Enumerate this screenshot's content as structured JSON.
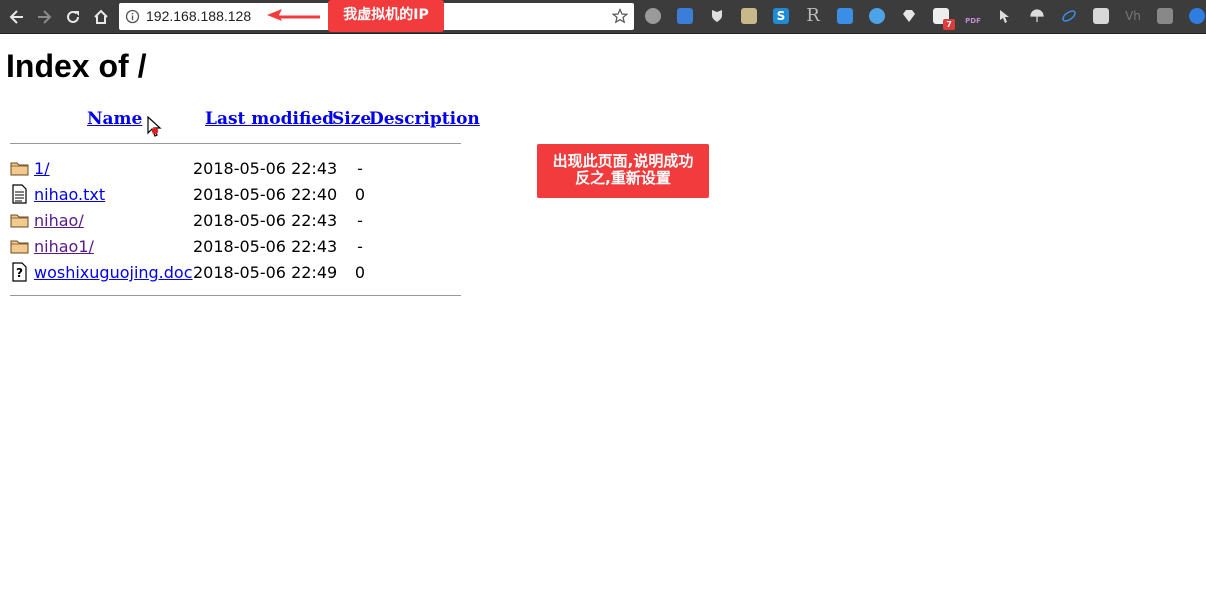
{
  "browser": {
    "url": "192.168.188.128",
    "callout_ip": "我虚拟机的IP"
  },
  "page": {
    "title": "Index of /",
    "columns": {
      "name": "Name",
      "last_modified": "Last modified",
      "size": "Size",
      "description": "Description"
    },
    "entries": [
      {
        "icon": "folder-icon",
        "name": "1/",
        "modified": "2018-05-06 22:43",
        "size": "-",
        "visited": false
      },
      {
        "icon": "text-file-icon",
        "name": "nihao.txt",
        "modified": "2018-05-06 22:40",
        "size": "0",
        "visited": false
      },
      {
        "icon": "folder-icon",
        "name": "nihao/",
        "modified": "2018-05-06 22:43",
        "size": "-",
        "visited": true
      },
      {
        "icon": "folder-icon",
        "name": "nihao1/",
        "modified": "2018-05-06 22:43",
        "size": "-",
        "visited": true
      },
      {
        "icon": "unknown-file-icon",
        "name": "woshixuguojing.doc",
        "modified": "2018-05-06 22:49",
        "size": "0",
        "visited": false
      }
    ]
  },
  "annotation": {
    "line1": "出现此页面,说明成功",
    "line2": "反之,重新设置"
  },
  "extensions": {
    "badge_count": "7",
    "pdf_label": "PDF",
    "r_label": "R",
    "vh_label": "Vh"
  },
  "colors": {
    "toolbar": "#3c3c3c",
    "callout": "#f23b3c",
    "link": "#0000ee",
    "visited": "#551a8b"
  }
}
